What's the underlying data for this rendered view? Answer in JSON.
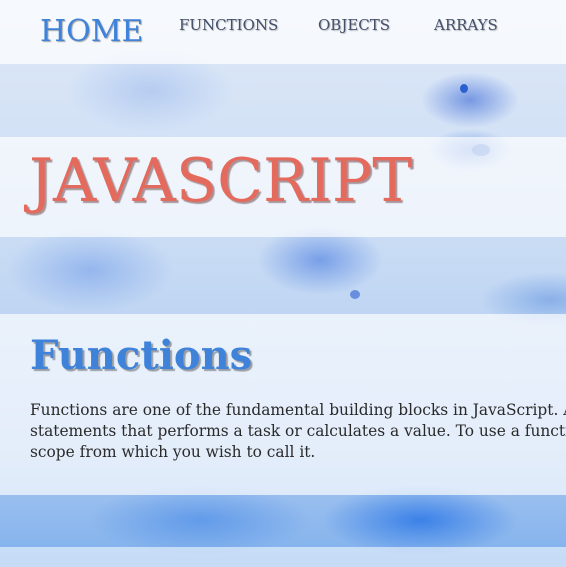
{
  "nav": {
    "home_label": "HOME",
    "items": [
      {
        "label": "FUNCTIONS"
      },
      {
        "label": "OBJECTS"
      },
      {
        "label": "ARRAYS"
      }
    ]
  },
  "hero": {
    "title": "JAVASCRIPT"
  },
  "section": {
    "title": "Functions",
    "body": "Functions are one of the fundamental building blocks in JavaScript. A function is a JavaScript procedure — a set of statements that performs a task or calculates a value. To use a function, you must define it somewhere in the scope from which you wish to call it."
  },
  "colors": {
    "accent_blue": "#3f82d9",
    "title_red": "#e46a5d",
    "nav_text": "#44506a"
  }
}
